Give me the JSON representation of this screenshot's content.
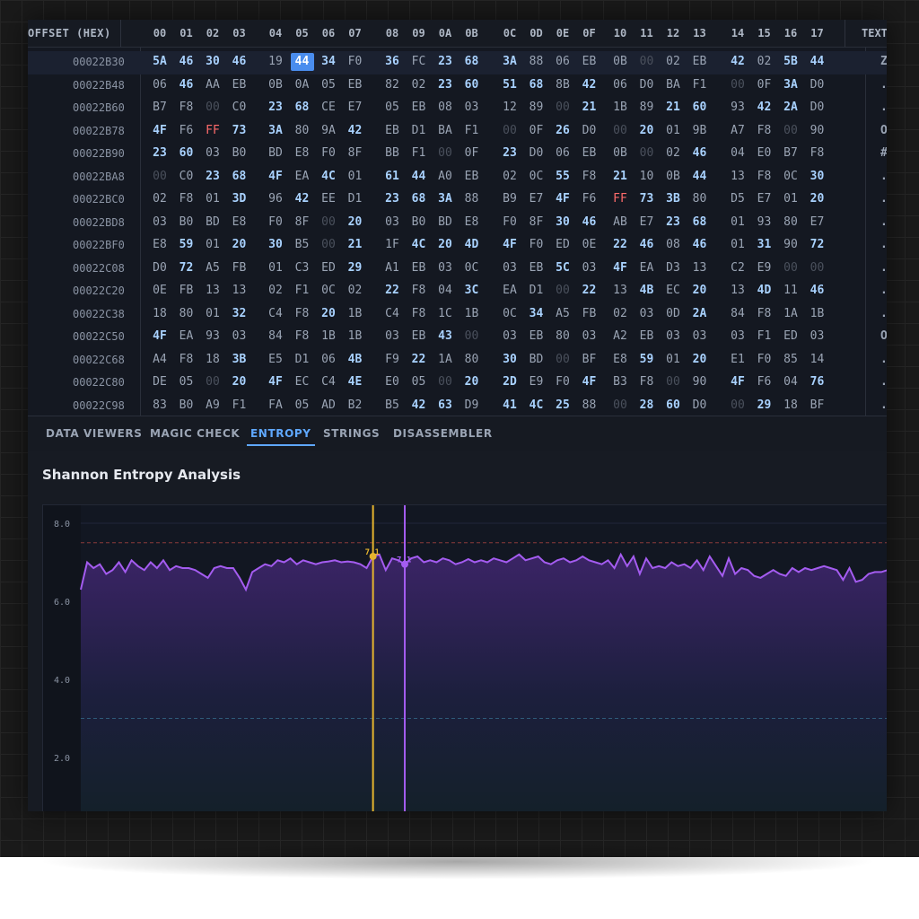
{
  "header": {
    "offset_label": "OFFSET (HEX)",
    "columns": [
      "00",
      "01",
      "02",
      "03",
      "04",
      "05",
      "06",
      "07",
      "08",
      "09",
      "0A",
      "0B",
      "0C",
      "0D",
      "0E",
      "0F",
      "10",
      "11",
      "12",
      "13",
      "14",
      "15",
      "16",
      "17"
    ],
    "text_label": "TEXT"
  },
  "rows": [
    {
      "offset": "00022B30",
      "bytes": [
        "5A",
        "46",
        "30",
        "46",
        "19",
        "44",
        "34",
        "F0",
        "36",
        "FC",
        "23",
        "68",
        "3A",
        "88",
        "06",
        "EB",
        "0B",
        "00",
        "02",
        "EB",
        "42",
        "02",
        "5B",
        "44"
      ],
      "text": "Z"
    },
    {
      "offset": "00022B48",
      "bytes": [
        "06",
        "46",
        "AA",
        "EB",
        "0B",
        "0A",
        "05",
        "EB",
        "82",
        "02",
        "23",
        "60",
        "51",
        "68",
        "8B",
        "42",
        "06",
        "D0",
        "BA",
        "F1",
        "00",
        "0F",
        "3A",
        "D0"
      ],
      "text": "."
    },
    {
      "offset": "00022B60",
      "bytes": [
        "B7",
        "F8",
        "00",
        "C0",
        "23",
        "68",
        "CE",
        "E7",
        "05",
        "EB",
        "08",
        "03",
        "12",
        "89",
        "00",
        "21",
        "1B",
        "89",
        "21",
        "60",
        "93",
        "42",
        "2A",
        "D0"
      ],
      "text": "."
    },
    {
      "offset": "00022B78",
      "bytes": [
        "4F",
        "F6",
        "FF",
        "73",
        "3A",
        "80",
        "9A",
        "42",
        "EB",
        "D1",
        "BA",
        "F1",
        "00",
        "0F",
        "26",
        "D0",
        "00",
        "20",
        "01",
        "9B",
        "A7",
        "F8",
        "00",
        "90"
      ],
      "text": "O"
    },
    {
      "offset": "00022B90",
      "bytes": [
        "23",
        "60",
        "03",
        "B0",
        "BD",
        "E8",
        "F0",
        "8F",
        "BB",
        "F1",
        "00",
        "0F",
        "23",
        "D0",
        "06",
        "EB",
        "0B",
        "00",
        "02",
        "46",
        "04",
        "E0",
        "B7",
        "F8"
      ],
      "text": "#"
    },
    {
      "offset": "00022BA8",
      "bytes": [
        "00",
        "C0",
        "23",
        "68",
        "4F",
        "EA",
        "4C",
        "01",
        "61",
        "44",
        "A0",
        "EB",
        "02",
        "0C",
        "55",
        "F8",
        "21",
        "10",
        "0B",
        "44",
        "13",
        "F8",
        "0C",
        "30"
      ],
      "text": "."
    },
    {
      "offset": "00022BC0",
      "bytes": [
        "02",
        "F8",
        "01",
        "3D",
        "96",
        "42",
        "EE",
        "D1",
        "23",
        "68",
        "3A",
        "88",
        "B9",
        "E7",
        "4F",
        "F6",
        "FF",
        "73",
        "3B",
        "80",
        "D5",
        "E7",
        "01",
        "20"
      ],
      "text": "."
    },
    {
      "offset": "00022BD8",
      "bytes": [
        "03",
        "B0",
        "BD",
        "E8",
        "F0",
        "8F",
        "00",
        "20",
        "03",
        "B0",
        "BD",
        "E8",
        "F0",
        "8F",
        "30",
        "46",
        "AB",
        "E7",
        "23",
        "68",
        "01",
        "93",
        "80",
        "E7"
      ],
      "text": "."
    },
    {
      "offset": "00022BF0",
      "bytes": [
        "E8",
        "59",
        "01",
        "20",
        "30",
        "B5",
        "00",
        "21",
        "1F",
        "4C",
        "20",
        "4D",
        "4F",
        "F0",
        "ED",
        "0E",
        "22",
        "46",
        "08",
        "46",
        "01",
        "31",
        "90",
        "72"
      ],
      "text": "."
    },
    {
      "offset": "00022C08",
      "bytes": [
        "D0",
        "72",
        "A5",
        "FB",
        "01",
        "C3",
        "ED",
        "29",
        "A1",
        "EB",
        "03",
        "0C",
        "03",
        "EB",
        "5C",
        "03",
        "4F",
        "EA",
        "D3",
        "13",
        "C2",
        "E9",
        "00",
        "00"
      ],
      "text": "."
    },
    {
      "offset": "00022C20",
      "bytes": [
        "0E",
        "FB",
        "13",
        "13",
        "02",
        "F1",
        "0C",
        "02",
        "22",
        "F8",
        "04",
        "3C",
        "EA",
        "D1",
        "00",
        "22",
        "13",
        "4B",
        "EC",
        "20",
        "13",
        "4D",
        "11",
        "46"
      ],
      "text": "."
    },
    {
      "offset": "00022C38",
      "bytes": [
        "18",
        "80",
        "01",
        "32",
        "C4",
        "F8",
        "20",
        "1B",
        "C4",
        "F8",
        "1C",
        "1B",
        "0C",
        "34",
        "A5",
        "FB",
        "02",
        "03",
        "0D",
        "2A",
        "84",
        "F8",
        "1A",
        "1B"
      ],
      "text": "."
    },
    {
      "offset": "00022C50",
      "bytes": [
        "4F",
        "EA",
        "93",
        "03",
        "84",
        "F8",
        "1B",
        "1B",
        "03",
        "EB",
        "43",
        "00",
        "03",
        "EB",
        "80",
        "03",
        "A2",
        "EB",
        "03",
        "03",
        "03",
        "F1",
        "ED",
        "03"
      ],
      "text": "O"
    },
    {
      "offset": "00022C68",
      "bytes": [
        "A4",
        "F8",
        "18",
        "3B",
        "E5",
        "D1",
        "06",
        "4B",
        "F9",
        "22",
        "1A",
        "80",
        "30",
        "BD",
        "00",
        "BF",
        "E8",
        "59",
        "01",
        "20",
        "E1",
        "F0",
        "85",
        "14"
      ],
      "text": "."
    },
    {
      "offset": "00022C80",
      "bytes": [
        "DE",
        "05",
        "00",
        "20",
        "4F",
        "EC",
        "C4",
        "4E",
        "E0",
        "05",
        "00",
        "20",
        "2D",
        "E9",
        "F0",
        "4F",
        "B3",
        "F8",
        "00",
        "90",
        "4F",
        "F6",
        "04",
        "76"
      ],
      "text": "."
    },
    {
      "offset": "00022C98",
      "bytes": [
        "83",
        "B0",
        "A9",
        "F1",
        "FA",
        "05",
        "AD",
        "B2",
        "B5",
        "42",
        "63",
        "D9",
        "41",
        "4C",
        "25",
        "88",
        "00",
        "28",
        "60",
        "D0",
        "00",
        "29",
        "18",
        "BF"
      ],
      "text": "."
    }
  ],
  "selected": {
    "row": 0,
    "col": 5
  },
  "tabs": [
    {
      "label": "DATA VIEWERS",
      "active": false
    },
    {
      "label": "MAGIC CHECK",
      "active": false
    },
    {
      "label": "ENTROPY",
      "active": true
    },
    {
      "label": "STRINGS",
      "active": false
    },
    {
      "label": "DISASSEMBLER",
      "active": false
    }
  ],
  "panel": {
    "title": "Shannon Entropy Analysis"
  },
  "chart_data": {
    "type": "area",
    "yticks": [
      "8.0",
      "6.0",
      "4.0",
      "2.0"
    ],
    "ylim": [
      0,
      8
    ],
    "threshold_high": 7.5,
    "threshold_low": 3.0,
    "values": [
      6.3,
      7.0,
      6.85,
      6.95,
      6.7,
      6.8,
      7.0,
      6.75,
      7.05,
      6.9,
      6.8,
      7.0,
      6.85,
      7.05,
      6.8,
      6.9,
      6.85,
      6.85,
      6.8,
      6.7,
      6.6,
      6.85,
      6.9,
      6.85,
      6.85,
      6.6,
      6.3,
      6.75,
      6.85,
      6.95,
      6.9,
      7.05,
      7.0,
      7.1,
      6.95,
      7.05,
      7.0,
      6.95,
      7.0,
      7.02,
      7.05,
      7.0,
      7.02,
      7.0,
      6.95,
      6.85,
      7.15,
      7.2,
      6.8,
      7.1,
      7.05,
      6.95,
      7.1,
      7.15,
      7.0,
      7.05,
      7.0,
      7.1,
      7.05,
      6.95,
      7.0,
      7.08,
      7.0,
      7.05,
      7.0,
      7.1,
      7.05,
      7.0,
      7.1,
      7.2,
      7.05,
      7.1,
      7.15,
      7.0,
      6.95,
      7.05,
      7.1,
      7.0,
      7.05,
      7.15,
      7.05,
      7.0,
      6.95,
      7.05,
      6.85,
      7.2,
      6.9,
      7.15,
      6.7,
      7.1,
      6.85,
      6.9,
      6.85,
      7.0,
      6.9,
      6.95,
      6.85,
      7.05,
      6.8,
      7.15,
      6.9,
      6.65,
      7.1,
      6.7,
      6.85,
      6.8,
      6.65,
      6.6,
      6.7,
      6.8,
      6.7,
      6.65,
      6.85,
      6.75,
      6.85,
      6.8,
      6.85,
      6.9,
      6.85,
      6.8,
      6.55,
      6.85,
      6.5,
      6.55,
      6.7,
      6.75,
      6.75,
      6.8
    ],
    "markers": [
      {
        "index": 46,
        "label": "7.1",
        "color": "#e6b52e"
      },
      {
        "index": 51,
        "label": "7.1",
        "color": "#a45cf0"
      }
    ]
  }
}
